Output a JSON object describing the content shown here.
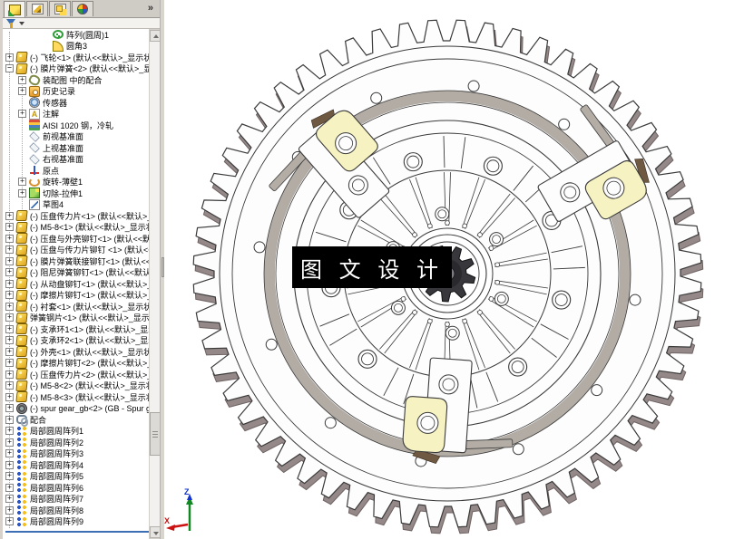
{
  "panel": {
    "chevron": "»",
    "tabs": [
      {
        "icon": "featuremanager",
        "active": true
      },
      {
        "icon": "propertymanager",
        "active": false
      },
      {
        "icon": "configurationmanager",
        "active": false
      },
      {
        "icon": "displaymanager",
        "active": false
      }
    ],
    "tree": [
      {
        "indent": 2,
        "expand": null,
        "icon": "pattern-circular",
        "label": "阵列(圆周)1"
      },
      {
        "indent": 2,
        "expand": null,
        "icon": "fillet",
        "label": "圆角3"
      },
      {
        "indent": 0,
        "expand": "plus",
        "icon": "part",
        "label": "(-) 飞轮<1> (默认<<默认>_显示状"
      },
      {
        "indent": 0,
        "expand": "minus",
        "icon": "part",
        "label": "(-) 膜片弹簧<2> (默认<<默认>_显"
      },
      {
        "indent": 1,
        "expand": "plus",
        "icon": "mate-group",
        "label": "装配图 中的配合"
      },
      {
        "indent": 1,
        "expand": "plus",
        "icon": "history",
        "label": "历史记录"
      },
      {
        "indent": 1,
        "expand": null,
        "icon": "sensor",
        "label": "传感器"
      },
      {
        "indent": 1,
        "expand": "plus",
        "icon": "annotation",
        "label": "注解"
      },
      {
        "indent": 1,
        "expand": null,
        "icon": "material",
        "label": "AISI 1020 钢，冷轧"
      },
      {
        "indent": 1,
        "expand": null,
        "icon": "plane",
        "label": "前视基准面"
      },
      {
        "indent": 1,
        "expand": null,
        "icon": "plane",
        "label": "上视基准面"
      },
      {
        "indent": 1,
        "expand": null,
        "icon": "plane",
        "label": "右视基准面"
      },
      {
        "indent": 1,
        "expand": null,
        "icon": "origin",
        "label": "原点"
      },
      {
        "indent": 1,
        "expand": "plus",
        "icon": "revolve",
        "label": "旋转-薄壁1"
      },
      {
        "indent": 1,
        "expand": "plus",
        "icon": "cut-extrude",
        "label": "切除-拉伸1"
      },
      {
        "indent": 1,
        "expand": null,
        "icon": "sketch",
        "label": "草图4"
      },
      {
        "indent": 0,
        "expand": "plus",
        "icon": "part",
        "label": "(-) 压盘传力片<1> (默认<<默认>_"
      },
      {
        "indent": 0,
        "expand": "plus",
        "icon": "part",
        "label": "(-) M5-8<1> (默认<<默认>_显示状"
      },
      {
        "indent": 0,
        "expand": "plus",
        "icon": "part",
        "label": "(-) 压盘与外壳铆钉<1> (默认<<默"
      },
      {
        "indent": 0,
        "expand": "plus",
        "icon": "part",
        "label": "(-) 压盘与传力片铆钉 <1> (默认<<"
      },
      {
        "indent": 0,
        "expand": "plus",
        "icon": "part",
        "label": "(-) 膜片弹簧联接铆钉<1> (默认<<"
      },
      {
        "indent": 0,
        "expand": "plus",
        "icon": "part",
        "label": "(-) 阻尼弹簧铆钉<1> (默认<<默认"
      },
      {
        "indent": 0,
        "expand": "plus",
        "icon": "part",
        "label": "(-) 从动盘铆钉<1> (默认<<默认>_"
      },
      {
        "indent": 0,
        "expand": "plus",
        "icon": "part",
        "label": "(-) 摩擦片铆钉<1> (默认<<默认>_"
      },
      {
        "indent": 0,
        "expand": "plus",
        "icon": "part",
        "label": "(-) 衬套<1> (默认<<默认>_显示状"
      },
      {
        "indent": 0,
        "expand": "plus",
        "icon": "part",
        "label": "弹簧钢片<1> (默认<<默认>_显示状"
      },
      {
        "indent": 0,
        "expand": "plus",
        "icon": "part",
        "label": "(-) 支承环1<1> (默认<<默认>_显示"
      },
      {
        "indent": 0,
        "expand": "plus",
        "icon": "part",
        "label": "(-) 支承环2<1> (默认<<默认>_显示"
      },
      {
        "indent": 0,
        "expand": "plus",
        "icon": "part",
        "label": "(-) 外壳<1> (默认<<默认>_显示状"
      },
      {
        "indent": 0,
        "expand": "plus",
        "icon": "part",
        "label": "(-) 摩擦片铆钉<2> (默认<<默认>_"
      },
      {
        "indent": 0,
        "expand": "plus",
        "icon": "part",
        "label": "(-) 压盘传力片<2> (默认<<默认>_"
      },
      {
        "indent": 0,
        "expand": "plus",
        "icon": "part",
        "label": "(-) M5-8<2> (默认<<默认>_显示状"
      },
      {
        "indent": 0,
        "expand": "plus",
        "icon": "part",
        "label": "(-) M5-8<3> (默认<<默认>_显示状"
      },
      {
        "indent": 0,
        "expand": "plus",
        "icon": "gear-part",
        "label": "(-) spur gear_gb<2> (GB - Spur g"
      },
      {
        "indent": 0,
        "expand": "plus",
        "icon": "mates",
        "label": "配合"
      },
      {
        "indent": 0,
        "expand": "plus",
        "icon": "local-pattern",
        "label": "局部圆周阵列1"
      },
      {
        "indent": 0,
        "expand": "plus",
        "icon": "local-pattern",
        "label": "局部圆周阵列2"
      },
      {
        "indent": 0,
        "expand": "plus",
        "icon": "local-pattern",
        "label": "局部圆周阵列3"
      },
      {
        "indent": 0,
        "expand": "plus",
        "icon": "local-pattern",
        "label": "局部圆周阵列4"
      },
      {
        "indent": 0,
        "expand": "plus",
        "icon": "local-pattern",
        "label": "局部圆周阵列5"
      },
      {
        "indent": 0,
        "expand": "plus",
        "icon": "local-pattern",
        "label": "局部圆周阵列6"
      },
      {
        "indent": 0,
        "expand": "plus",
        "icon": "local-pattern",
        "label": "局部圆周阵列7"
      },
      {
        "indent": 0,
        "expand": "plus",
        "icon": "local-pattern",
        "label": "局部圆周阵列8"
      },
      {
        "indent": 0,
        "expand": "plus",
        "icon": "local-pattern",
        "label": "局部圆周阵列9"
      }
    ]
  },
  "viewport": {
    "watermark": "图 文 设 计",
    "triad": {
      "x": "X",
      "z": "Z"
    },
    "colors": {
      "line": "#3a3a3a",
      "tooth_shadow": "#948888",
      "band": "#a59e95",
      "clip_yellow": "#f6f2c2",
      "clip_brown": "#6f5942",
      "hub_dark": "#38383c",
      "rollback_blue": "#3c6eb5",
      "triad_x": "#cc1111",
      "triad_y": "#118822",
      "triad_z": "#1133cc"
    }
  }
}
